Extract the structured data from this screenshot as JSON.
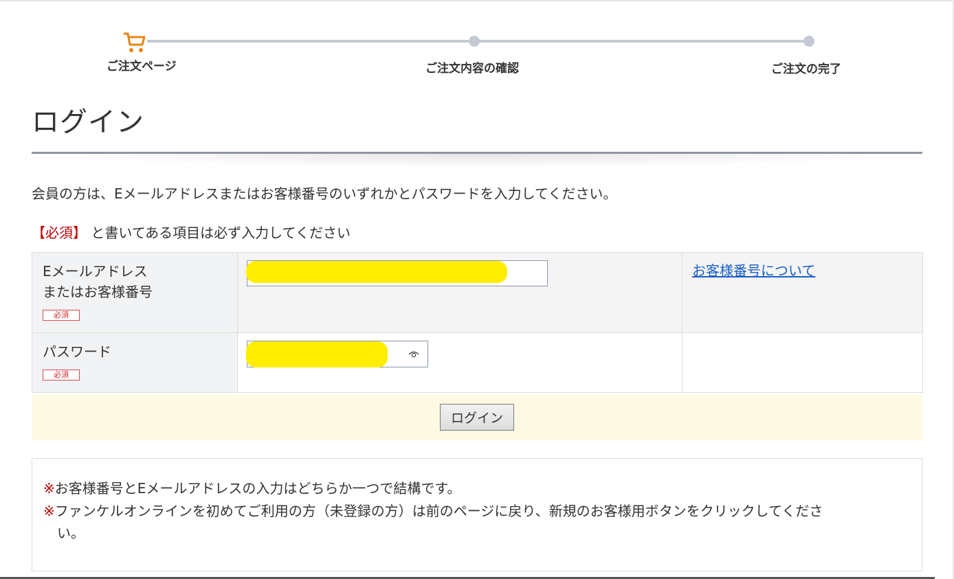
{
  "progress": {
    "steps": [
      {
        "label": "ご注文ページ",
        "state": "current"
      },
      {
        "label": "ご注文内容の確認",
        "state": "pending"
      },
      {
        "label": "ご注文の完了",
        "state": "pending"
      }
    ],
    "accent_color": "#e88410",
    "track_color": "#c5c9d3"
  },
  "page": {
    "title": "ログイン",
    "intro": "会員の方は、Eメールアドレスまたはお客様番号のいずれかとパスワードを入力してください。",
    "required_marker": "【必須】",
    "required_note": "と書いてある項目は必ず入力してください"
  },
  "form": {
    "email": {
      "label_line1": "Eメールアドレス",
      "label_line2": "またはお客様番号",
      "badge": "必須",
      "help_link": "お客様番号について"
    },
    "password": {
      "label": "パスワード",
      "badge": "必須",
      "icon": "eye-icon"
    },
    "redaction_color": "#ffee00"
  },
  "actions": {
    "login_button": "ログイン"
  },
  "notes": [
    {
      "mark": "※",
      "text": "お客様番号とEメールアドレスの入力はどちらか一つで結構です。"
    },
    {
      "mark": "※",
      "text_line1": "ファンケルオンラインを初めてご利用の方（未登録の方）は前のページに戻り、新規のお客様用ボタンをクリックしてくださ",
      "text_line2": "い。"
    }
  ]
}
